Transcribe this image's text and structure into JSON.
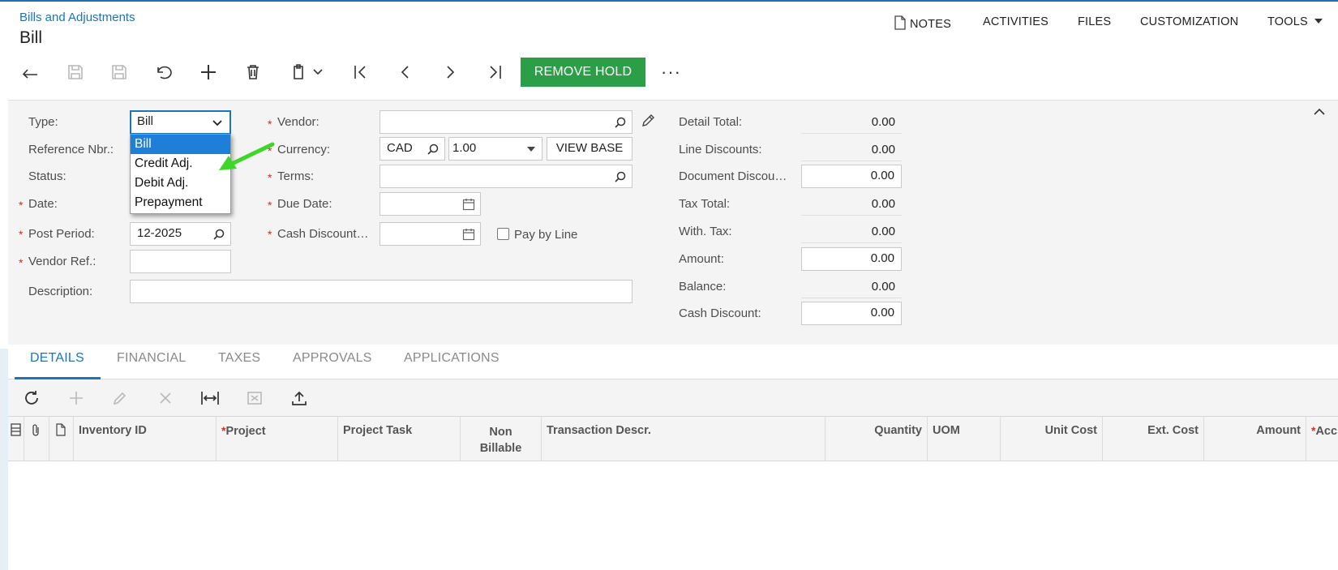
{
  "header": {
    "breadcrumb": "Bills and Adjustments",
    "title": "Bill",
    "nav": {
      "notes": "NOTES",
      "activities": "ACTIVITIES",
      "files": "FILES",
      "customization": "CUSTOMIZATION",
      "tools": "TOOLS"
    }
  },
  "toolbar": {
    "remove_hold": "REMOVE HOLD",
    "more": "···",
    "icons": [
      "back-icon",
      "save-close-icon",
      "save-icon",
      "undo-icon",
      "add-icon",
      "delete-icon",
      "copy-paste-icon",
      "first-icon",
      "prev-icon",
      "next-icon",
      "last-icon"
    ]
  },
  "form": {
    "type": {
      "label": "Type:",
      "value": "Bill"
    },
    "reference_nbr": {
      "label": "Reference Nbr.:"
    },
    "status": {
      "label": "Status:"
    },
    "date": {
      "label": "Date:"
    },
    "post_period": {
      "label": "Post Period:",
      "value": "12-2025"
    },
    "vendor_ref": {
      "label": "Vendor Ref.:",
      "value": ""
    },
    "description": {
      "label": "Description:",
      "value": ""
    },
    "vendor": {
      "label": "Vendor:",
      "value": ""
    },
    "currency": {
      "label": "Currency:",
      "value": "CAD",
      "rate": "1.00",
      "view_base": "VIEW BASE"
    },
    "terms": {
      "label": "Terms:",
      "value": ""
    },
    "due_date": {
      "label": "Due Date:",
      "value": ""
    },
    "cash_discount_date": {
      "label": "Cash Discount…",
      "value": ""
    },
    "pay_by_line": {
      "label": "Pay by Line",
      "checked": false
    }
  },
  "type_dropdown": {
    "options": [
      "Bill",
      "Credit Adj.",
      "Debit Adj.",
      "Prepayment"
    ],
    "selected": "Bill"
  },
  "summary": {
    "detail_total": {
      "label": "Detail Total:",
      "value": "0.00"
    },
    "line_discounts": {
      "label": "Line Discounts:",
      "value": "0.00"
    },
    "document_discount": {
      "label": "Document Discou…",
      "value": "0.00"
    },
    "tax_total": {
      "label": "Tax Total:",
      "value": "0.00"
    },
    "with_tax": {
      "label": "With. Tax:",
      "value": "0.00"
    },
    "amount": {
      "label": "Amount:",
      "value": "0.00"
    },
    "balance": {
      "label": "Balance:",
      "value": "0.00"
    },
    "cash_discount": {
      "label": "Cash Discount:",
      "value": "0.00"
    }
  },
  "tabs": [
    "DETAILS",
    "FINANCIAL",
    "TAXES",
    "APPROVALS",
    "APPLICATIONS"
  ],
  "active_tab": "DETAILS",
  "grid": {
    "columns": {
      "inventory_id": "Inventory ID",
      "project": "Project",
      "project_task": "Project Task",
      "non_billable_1": "Non",
      "non_billable_2": "Billable",
      "transaction_descr": "Transaction Descr.",
      "quantity": "Quantity",
      "uom": "UOM",
      "unit_cost": "Unit Cost",
      "ext_cost": "Ext. Cost",
      "amount": "Amount",
      "account": "Acc"
    },
    "rows": []
  },
  "colors": {
    "accent": "#1b75bb",
    "primary_button": "#2b9e47",
    "required": "#c9302c",
    "annotation_arrow": "#3fd62a",
    "selected_option": "#1e7fd9"
  }
}
